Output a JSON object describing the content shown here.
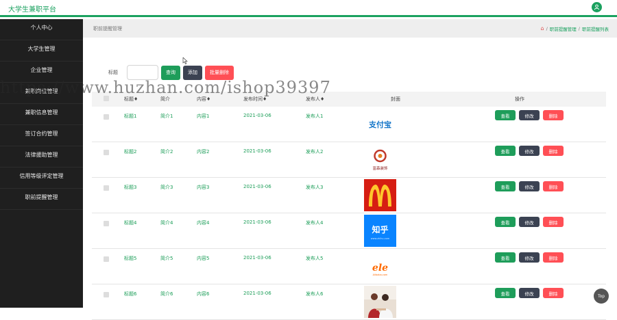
{
  "app": {
    "title": "大学生兼职平台"
  },
  "sidebar": {
    "items": [
      {
        "label": "个人中心"
      },
      {
        "label": "大学生管理"
      },
      {
        "label": "企业管理"
      },
      {
        "label": "兼职岗位管理"
      },
      {
        "label": "兼职信息管理"
      },
      {
        "label": "签订合约管理"
      },
      {
        "label": "法律援助管理"
      },
      {
        "label": "信用等级评定管理"
      },
      {
        "label": "职前提醒管理"
      }
    ]
  },
  "page": {
    "title": "职前提醒管理"
  },
  "breadcrumb": {
    "items": [
      "职前提醒管理",
      "职前提醒列表"
    ]
  },
  "search": {
    "label": "标题",
    "value": "",
    "query_label": "查询",
    "add_label": "添加",
    "batch_delete_label": "批量删除"
  },
  "table": {
    "headers": [
      "标题♦",
      "简介",
      "内容♦",
      "发布时间♦",
      "发布人♦",
      "封面",
      "操作"
    ],
    "rows": [
      {
        "title": "标题1",
        "intro": "简介1",
        "content": "内容1",
        "time": "2021-03-06",
        "publisher": "发布人1",
        "cover": "alipay"
      },
      {
        "title": "标题2",
        "intro": "简介2",
        "content": "内容2",
        "time": "2021-03-06",
        "publisher": "发布人2",
        "cover": "decor"
      },
      {
        "title": "标题3",
        "intro": "简介3",
        "content": "内容3",
        "time": "2021-03-06",
        "publisher": "发布人3",
        "cover": "mcdonalds"
      },
      {
        "title": "标题4",
        "intro": "简介4",
        "content": "内容4",
        "time": "2021-03-06",
        "publisher": "发布人4",
        "cover": "zhihu"
      },
      {
        "title": "标题5",
        "intro": "简介5",
        "content": "内容5",
        "time": "2021-03-06",
        "publisher": "发布人5",
        "cover": "eleme"
      },
      {
        "title": "标题6",
        "intro": "简介6",
        "content": "内容6",
        "time": "2021-03-06",
        "publisher": "发布人6",
        "cover": "photo"
      }
    ],
    "row_actions": {
      "view": "查看",
      "edit": "修改",
      "delete": "删除"
    }
  },
  "watermark": "https://www.huzhan.com/ishop39397",
  "back_to_top": "Top",
  "colors": {
    "accent": "#1aa15f",
    "danger": "#ff4f55",
    "dark": "#3b4252",
    "sidebar": "#1f1f1f"
  }
}
